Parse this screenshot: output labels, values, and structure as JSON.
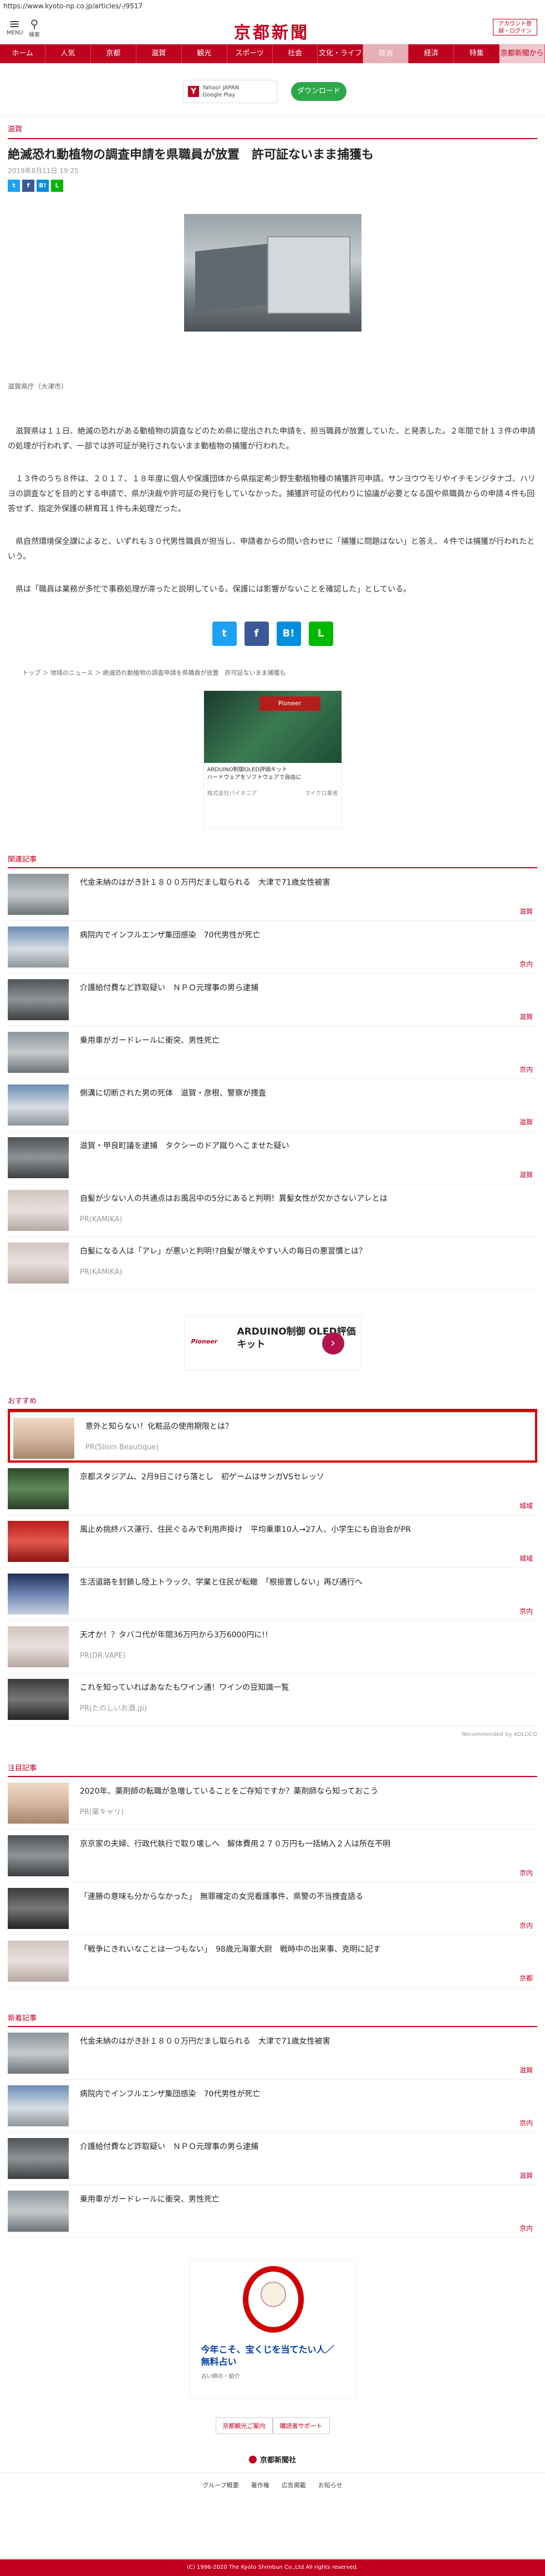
{
  "url": "https://www.kyoto-np.co.jp/articles/-/9517",
  "header": {
    "menu_label": "MENU",
    "search_label": "検索",
    "logo": "京都新聞",
    "login_label": "アカウント登録・ログイン"
  },
  "nav": [
    "ホーム",
    "人気",
    "京都",
    "滋賀",
    "観光",
    "スポーツ",
    "社会",
    "文化・ライフ",
    "政治",
    "経済",
    "特集",
    "京都新聞から"
  ],
  "app_promo": {
    "store": "Yahoo! JAPAN",
    "store_sub": "Google Play",
    "download": "ダウンロード"
  },
  "article": {
    "category": "滋賀",
    "title": "絶滅恐れ動植物の調査申請を県職員が放置　許可証ないまま捕獲も",
    "date": "2019年8月11日 19:25",
    "caption": "滋賀県庁（大津市）",
    "paragraphs": [
      "　滋賀県は１１日、絶滅の恐れがある動植物の調査などのため県に提出された申請を、担当職員が放置していた、と発表した。２年間で計１３件の申請の処理が行われず、一部では許可証が発行されないまま動植物の捕獲が行われた。",
      "　１３件のうち８件は、２０１７、１８年度に個人や保護団体から県指定希少野生動植物種の捕獲許可申請。サンヨウウモリやイチモンジタナゴ、ハリヨの調査などを目的とする申請で、県が決裁や許可証の発行をしていなかった。捕獲許可証の代わりに協議が必要となる国や県職員からの申請４件も回答せず、指定外保護の耕育耳１件も未処理だった。",
      "　県自然環境保全課によると、いずれも３０代男性職員が担当し、申請者からの問い合わせに「捕獲に問題はない」と答え、４件では捕獲が行われたという。",
      "　県は「職員は業務が多忙で事務処理が滞ったと説明している。保護には影響がないことを確認した」としている。"
    ]
  },
  "breadcrumb": [
    "トップ",
    "地域のニュース",
    "絶滅恐れ動植物の調査申請を県職員が放置　許可証ないまま捕獲も"
  ],
  "ad1": {
    "title": "ARDUINO制御OLED評価キット",
    "desc": "ハードウェアをソフトウェアで自由に",
    "sponsor": "株式会社パイオニア",
    "more": "マイクロ業者"
  },
  "related_title": "関連記事",
  "related": [
    {
      "title": "代金未納のはがき計１８００万円だまし取られる　大津で71歳女性被害",
      "tag": "滋賀"
    },
    {
      "title": "病院内でインフルエンザ集団感染　70代男性が死亡",
      "tag": "京内"
    },
    {
      "title": "介護給付費など詐取疑い　ＮＰＯ元理事の男ら逮捕",
      "tag": "滋賀"
    },
    {
      "title": "乗用車がガードレールに衝突、男性死亡",
      "tag": "京内"
    },
    {
      "title": "側溝に切断された男の死体　滋賀・彦根、警察が捜査",
      "tag": "滋賀"
    },
    {
      "title": "滋賀・甲良町議を逮捕　タクシーのドア蹴りへこませた疑い",
      "tag": "滋賀"
    },
    {
      "title": "自髪が少ない人の共通点はお風呂中の5分にあると判明！異髪女性が欠かさないアレとは",
      "pr": "PR(KAMIKA)"
    },
    {
      "title": "白髪になる人は「アレ」が悪いと判明!?自髪が増えやすい人の毎日の悪習慣とは？",
      "pr": "PR(KAMIKA)"
    }
  ],
  "ad2": {
    "brand": "Pioneer",
    "text": "ARDUINO制御 OLED評価 キット"
  },
  "osusume_title": "おすすめ",
  "osusume": [
    {
      "title": "意外と知らない！化粧品の使用期限とは？",
      "pr": "PR(Slism Beautique)"
    },
    {
      "title": "京都スタジアム、2月9日こけら落とし　初ゲームはサンガVSセレッソ",
      "tag": "城域"
    },
    {
      "title": "風止め挑終バス運行、住民ぐるみで利用声掛け　平均乗車10人→27人、小学生にも自治会がPR",
      "tag": "城域"
    },
    {
      "title": "生活道路を封鎖し陸上トラック、学業と住民が転轍　「根振置しない」再び通行へ",
      "tag": "京内"
    },
    {
      "title": "天才か！？タバコ代が年間36万円から3万6000円に!!",
      "pr": "PR(DR.VAPE)"
    },
    {
      "title": "これを知っていればあなたもワイン通！ワインの豆知識一覧",
      "pr": "PR(たのしいお酒.jp)"
    }
  ],
  "recommended_by": "Recommended by ADLOCO",
  "chumoku_title": "注目記事",
  "chumoku": [
    {
      "title": "2020年、薬剤師の転職が急増していることをご存知ですか？薬剤師なら知っておこう",
      "pr": "PR(薬キャリ)"
    },
    {
      "title": "京京家の夫婦、行政代執行で取り壊しへ　解体費用２７０万円も一括納入２人は所在不明",
      "tag": "京内"
    },
    {
      "title": "「連勝の意味も分からなかった」　無罪確定の女児看護事件、県警の不当捜査語る",
      "tag": "京内"
    },
    {
      "title": "「戦争にきれいなことは一つもない」　98歳元海軍大尉　戦時中の出来事、克明に記す",
      "tag": "京都"
    }
  ],
  "new_title": "新着記事",
  "new": [
    {
      "title": "代金未納のはがき計１８００万円だまし取られる　大津で71歳女性被害",
      "tag": "滋賀"
    },
    {
      "title": "病院内でインフルエンザ集団感染　70代男性が死亡",
      "tag": "京内"
    },
    {
      "title": "介護給付費など詐取疑い　ＮＰＯ元理事の男ら逮捕",
      "tag": "滋賀"
    },
    {
      "title": "乗用車がガードレールに衝突、男性死亡",
      "tag": "京内"
    }
  ],
  "ad3": {
    "copy1": "今年こそ、宝くじを当てたい人／",
    "copy2": "無料占い",
    "small": "占い師の・紹介"
  },
  "bottom_links": [
    "京都観光ご案内",
    "購読者サポート"
  ],
  "footer": {
    "brand": "京都新聞社",
    "links": [
      "グループ概要",
      "著作権",
      "広告掲載",
      "お知らせ"
    ],
    "copyright": "(C) 1996-2020 The Kyoto Shimbun Co.,Ltd All rights reserved."
  },
  "colors": {
    "brand": "#c1001f",
    "line": "#00b900",
    "twitter": "#1da1f2",
    "facebook": "#3b5998",
    "hatena": "#008fde"
  }
}
